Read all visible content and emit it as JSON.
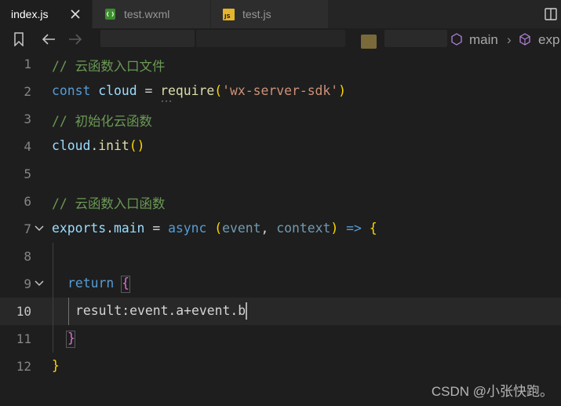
{
  "tabs": [
    {
      "label": "index.js",
      "active": true,
      "close_icon": "close-icon"
    },
    {
      "label": "test.wxml",
      "active": false,
      "icon": "wxml-file-icon"
    },
    {
      "label": "test.js",
      "active": false,
      "icon": "js-file-icon"
    }
  ],
  "breadcrumb": {
    "branch": "main",
    "symbol": "exp"
  },
  "editor": {
    "current_line": 10,
    "lines": [
      {
        "n": "1"
      },
      {
        "n": "2"
      },
      {
        "n": "3"
      },
      {
        "n": "4"
      },
      {
        "n": "5"
      },
      {
        "n": "6"
      },
      {
        "n": "7"
      },
      {
        "n": "8"
      },
      {
        "n": "9"
      },
      {
        "n": "10"
      },
      {
        "n": "11"
      },
      {
        "n": "12"
      }
    ],
    "code": {
      "l1": "// 云函数入口文件",
      "l2_const": "const",
      "l2_cloud": "cloud",
      "l2_eq": "=",
      "l2_req": "require",
      "l2_str": "'wx-server-sdk'",
      "l3": "// 初始化云函数",
      "l4_cloud": "cloud",
      "l4_init": "init",
      "l6": "// 云函数入口函数",
      "l7_exports": "exports",
      "l7_main": "main",
      "l7_async": "async",
      "l7_event": "event",
      "l7_context": "context",
      "l9_return": "return",
      "l10_result": "result",
      "l10_expr": "event.a+event.b"
    }
  },
  "watermark": "CSDN @小张快跑。",
  "colors": {
    "background": "#1e1e1e",
    "comment": "#6a9955",
    "keyword": "#569cd6",
    "string": "#ce9178",
    "function": "#dcdcaa"
  }
}
